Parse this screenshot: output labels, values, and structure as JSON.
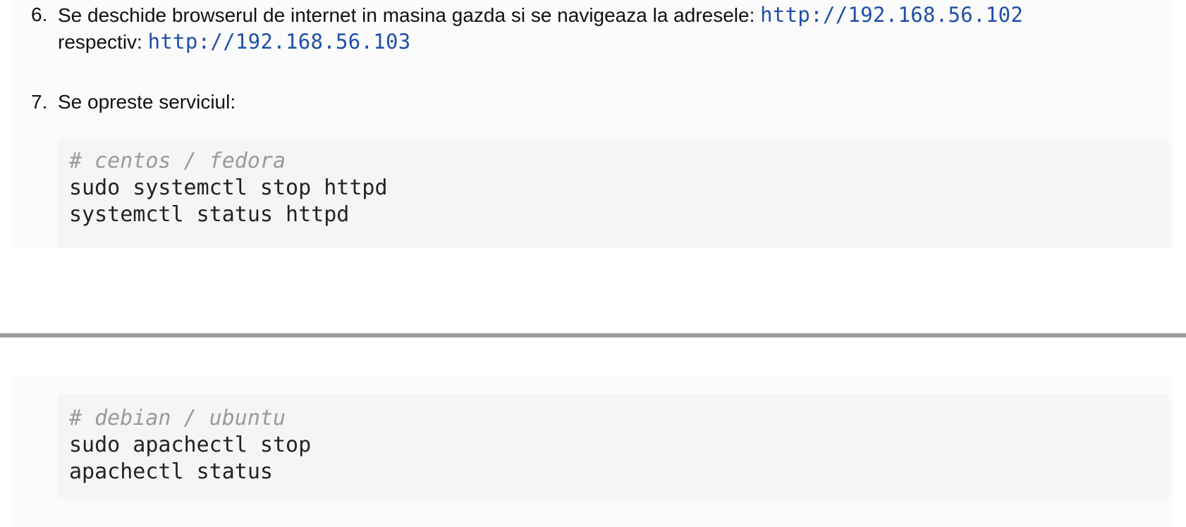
{
  "steps": [
    {
      "number": "6.",
      "text_before": "Se deschide browserul de internet in masina gazda si se navigeaza la adresele: ",
      "link1": "http://192.168.56.102",
      "text_middle": "respectiv: ",
      "link2": "http://192.168.56.103"
    },
    {
      "number": "7.",
      "text": "Se opreste serviciul:"
    }
  ],
  "code_blocks": [
    {
      "lines": [
        "# centos / fedora",
        "sudo systemctl stop httpd",
        "systemctl status httpd"
      ]
    },
    {
      "lines": [
        "# debian / ubuntu",
        "sudo apachectl stop",
        "apachectl status"
      ]
    }
  ],
  "colors": {
    "link": "#1f4fa8",
    "comment": "#9a9a9a",
    "code_bg": "#f5f5f5",
    "panel_bg": "#fbfbfb",
    "divider": "#9b9b9b"
  }
}
